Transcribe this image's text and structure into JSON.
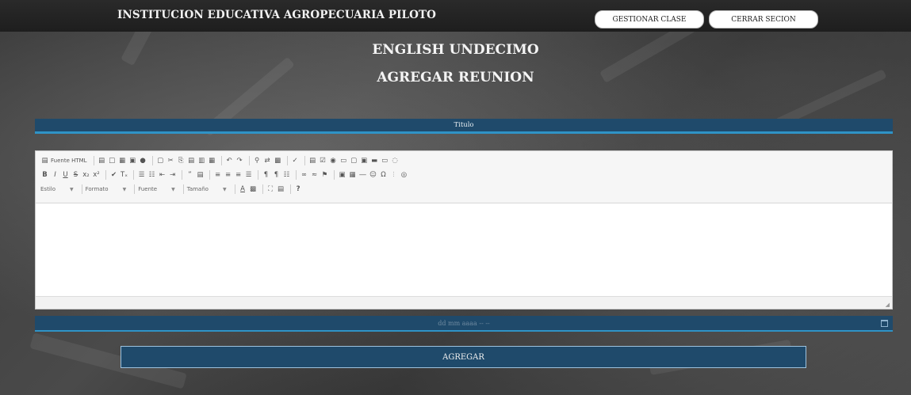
{
  "header": {
    "brand": "INSTITUCION EDUCATIVA AGROPECUARIA PILOTO",
    "gestionar_label": "GESTIONAR CLASE",
    "cerrar_label": "CERRAR SECION"
  },
  "page": {
    "course": "ENGLISH UNDECIMO",
    "action": "AGREGAR REUNION"
  },
  "form": {
    "titulo_label": "Titulo",
    "date_placeholder": "dd mm aaaa -- --",
    "submit_label": "AGREGAR"
  },
  "editor": {
    "source_label": "Fuente HTML",
    "combos": [
      "Estilo",
      "Formato",
      "Fuente",
      "Tamaño"
    ],
    "row1_icons": [
      "save-icon",
      "new-page-icon",
      "templates-icon",
      "preview-icon",
      "print-icon",
      "paste-plain-icon",
      "cut-icon",
      "copy-icon",
      "paste-icon",
      "paste-text-icon",
      "paste-word-icon",
      "undo-icon",
      "redo-icon",
      "find-icon",
      "replace-icon",
      "select-all-icon",
      "spellcheck-icon",
      "form-icon",
      "checkbox-icon",
      "radio-icon",
      "textfield-icon",
      "textarea-icon",
      "select-icon",
      "button-icon",
      "imagebutton-icon",
      "hiddenfield-icon"
    ],
    "row2_icons": [
      "bold-icon",
      "italic-icon",
      "underline-icon",
      "strike-icon",
      "subscript-icon",
      "superscript-icon",
      "copyformat-icon",
      "removeformat-icon",
      "numbered-list-icon",
      "bullet-list-icon",
      "outdent-icon",
      "indent-icon",
      "blockquote-icon",
      "div-icon",
      "align-left-icon",
      "align-center-icon",
      "align-right-icon",
      "justify-icon",
      "ltr-icon",
      "rtl-icon",
      "language-icon",
      "link-icon",
      "unlink-icon",
      "anchor-icon",
      "image-icon",
      "table-icon",
      "hline-icon",
      "smiley-icon",
      "specialchar-icon",
      "pagebreak-icon",
      "iframe-icon"
    ],
    "row3_icons": [
      "text-color-icon",
      "bg-color-icon",
      "maximize-icon",
      "showblocks-icon",
      "help-icon"
    ]
  }
}
